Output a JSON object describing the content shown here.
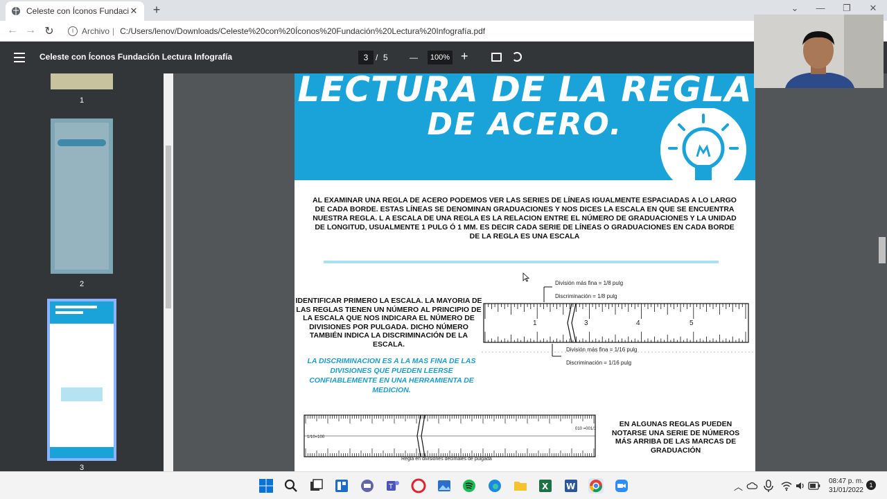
{
  "browser": {
    "tab_title": "Celeste con Íconos Fundación Le",
    "tab_close": "✕",
    "new_tab": "+",
    "window_controls": [
      "⌄",
      "—",
      "❐",
      "✕"
    ],
    "nav": {
      "back": "←",
      "forward": "→",
      "reload": "↻"
    },
    "address_label": "Archivo",
    "address_url": "C:/Users/lenov/Downloads/Celeste%20con%20Íconos%20Fundación%20Lectura%20Infografía.pdf"
  },
  "pdf_viewer": {
    "doc_title": "Celeste con Íconos Fundación Lectura Infografía",
    "current_page": "3",
    "page_sep": "/",
    "total_pages": "5",
    "zoom": "100%",
    "zoom_minus": "—",
    "zoom_plus": "+",
    "thumbnails": [
      {
        "num": "1"
      },
      {
        "num": "2"
      },
      {
        "num": "3"
      }
    ]
  },
  "page": {
    "hero_line1": "LECTURA DE LA REGLA",
    "hero_line2": "DE ACERO.",
    "intro": "AL EXAMINAR UNA REGLA DE ACERO PODEMOS VER LAS SERIES DE LÍNEAS IGUALMENTE ESPACIADAS A LO LARGO DE CADA BORDE. ESTAS LÍNEAS SE DENOMINAN GRADUACIONES Y NOS DICES LA ESCALA EN QUE SE ENCUENTRA NUESTRA REGLA. L A ESCALA DE UNA REGLA ES LA RELACION ENTRE EL NÚMERO DE GRADUACIONES Y LA UNIDAD DE LONGITUD, USUALMENTE 1 PULG Ó 1 MM. ES DECIR CADA SERIE DE LÍNEAS O GRADUACIONES EN CADA BORDE DE LA REGLA ES UNA ESCALA",
    "identificar": "IDENTIFICAR PRIMERO LA ESCALA. LA MAYORIA DE LAS REGLAS TIENEN UN NÚMERO AL PRINCIPIO DE LA ESCALA QUE NOS INDICARA EL NÚMERO DE DIVISIONES POR PULGADA. DICHO NÚMERO TAMBIÉN INDICA LA DISCRIMINACIÓN DE LA ESCALA.",
    "discriminacion": "LA DISCRIMINACION ES A LA MAS FINA DE LAS DIVISIONES QUE PUEDEN LEERSE CONFIABLEMENTE EN UNA HERRAMIENTA DE MEDICION.",
    "ruler1_labels": {
      "div_fina_8": "División más fina = 1/8 pulg",
      "disc_8": "Discriminación = 1/8 pulg",
      "div_fina_16": "División más fina = 1/16 pulg",
      "disc_16": "Discriminación = 1/16 pulg",
      "numbers": [
        "1",
        "3",
        "4",
        "5"
      ]
    },
    "ruler2_caption": "Regla en divisiones decimales de pulgada",
    "ruler2_scale": "1/10=100",
    "ruler2_scale_right": "010 =001/1",
    "algunas": "EN ALGUNAS REGLAS PUEDEN NOTARSE UNA SERIE DE NÚMEROS MÁS ARRIBA DE LAS MARCAS DE GRADUACIÓN"
  },
  "taskbar": {
    "time": "08:47 p. m.",
    "date": "31/01/2022",
    "notif_count": "1"
  }
}
